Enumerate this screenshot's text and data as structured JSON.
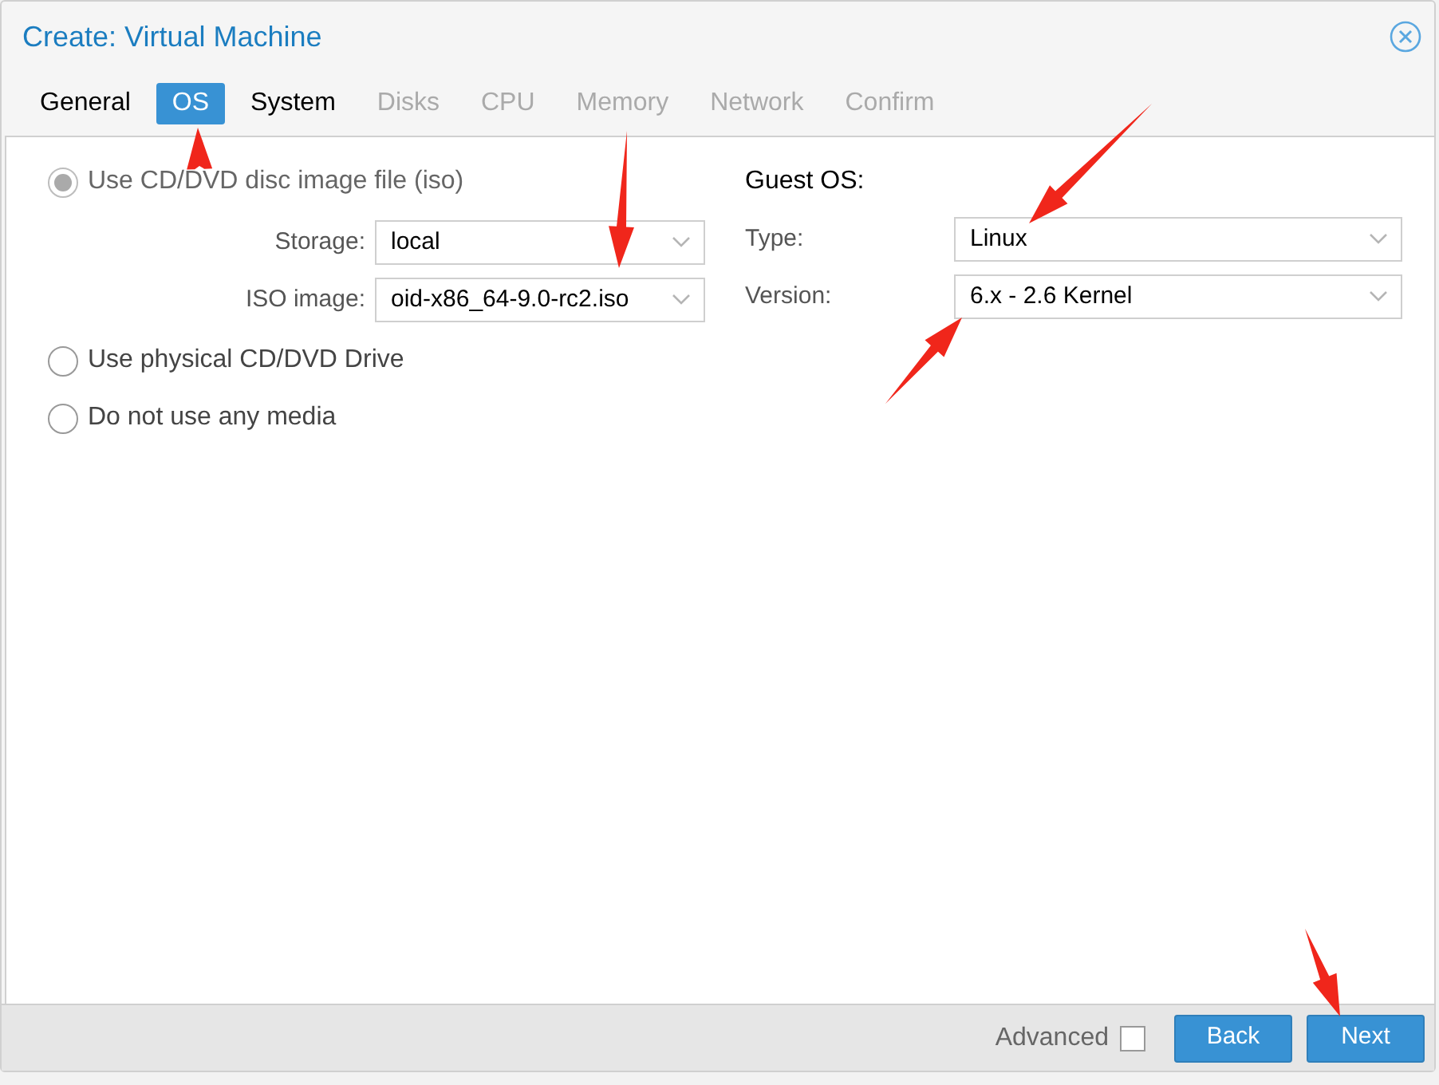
{
  "window": {
    "title": "Create: Virtual Machine"
  },
  "tabs": [
    {
      "label": "General",
      "selected": false,
      "disabled": false
    },
    {
      "label": "OS",
      "selected": true,
      "disabled": false
    },
    {
      "label": "System",
      "selected": false,
      "disabled": false
    },
    {
      "label": "Disks",
      "selected": false,
      "disabled": true
    },
    {
      "label": "CPU",
      "selected": false,
      "disabled": true
    },
    {
      "label": "Memory",
      "selected": false,
      "disabled": true
    },
    {
      "label": "Network",
      "selected": false,
      "disabled": true
    },
    {
      "label": "Confirm",
      "selected": false,
      "disabled": true
    }
  ],
  "media": [
    {
      "label": "Use CD/DVD disc image file (iso)",
      "selected": true,
      "disabled": true,
      "fields": [
        {
          "label": "Storage:",
          "value": "local"
        },
        {
          "label": "ISO image:",
          "value": "oid-x86_64-9.0-rc2.iso"
        }
      ]
    },
    {
      "label": "Use physical CD/DVD Drive",
      "selected": false,
      "disabled": false
    },
    {
      "label": "Do not use any media",
      "selected": false,
      "disabled": false
    }
  ],
  "guest_os": {
    "heading": "Guest OS:",
    "fields": [
      {
        "label": "Type:",
        "value": "Linux"
      },
      {
        "label": "Version:",
        "value": "6.x - 2.6 Kernel"
      }
    ]
  },
  "footer": {
    "advanced": {
      "label": "Advanced",
      "checked": false
    },
    "buttons": [
      "Back",
      "Next"
    ]
  }
}
